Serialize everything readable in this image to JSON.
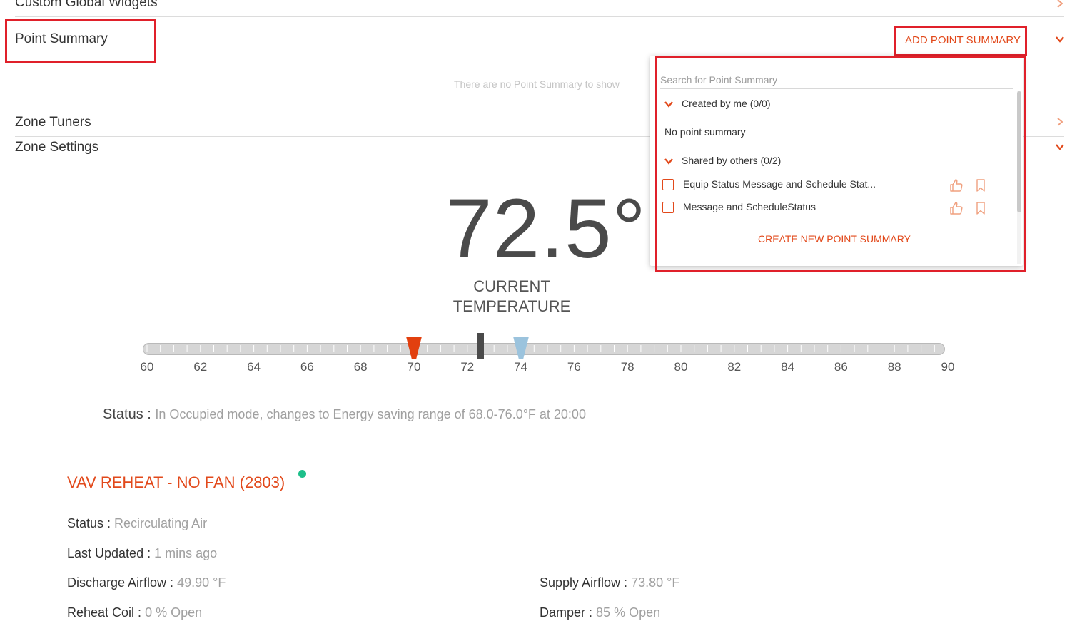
{
  "sections": {
    "custom_global_widgets": "Custom Global Widgets",
    "point_summary": "Point Summary",
    "point_summary_empty": "There are no Point Summary to show",
    "add_point_summary": "ADD POINT SUMMARY",
    "zone_tuners": "Zone Tuners",
    "zone_settings": "Zone Settings"
  },
  "temperature": {
    "value": "72.5°",
    "label_line1": "CURRENT",
    "label_line2": "TEMPERATURE",
    "current": 72.5,
    "heating_setpoint": 70,
    "cooling_setpoint": 74,
    "scale_min": 60,
    "scale_max": 90,
    "ticks": [
      "60",
      "62",
      "64",
      "66",
      "68",
      "70",
      "72",
      "74",
      "76",
      "78",
      "80",
      "82",
      "84",
      "86",
      "88",
      "90"
    ]
  },
  "status": {
    "label": "Status :",
    "value": "In Occupied mode, changes to Energy saving range of 68.0-76.0°F at 20:00"
  },
  "device": {
    "title": "VAV REHEAT - NO FAN (2803)",
    "online_color": "#1dbf8a",
    "status_label": "Status :",
    "status_value": "Recirculating Air",
    "updated_label": "Last Updated :",
    "updated_value": "1 mins ago",
    "discharge_label": "Discharge Airflow :",
    "discharge_value": "49.90 °F",
    "supply_label": "Supply Airflow :",
    "supply_value": "73.80 °F",
    "reheat_label": "Reheat Coil :",
    "reheat_value": "0 % Open",
    "damper_label": "Damper :",
    "damper_value": "85 % Open"
  },
  "dropdown": {
    "search_placeholder": "Search for Point Summary",
    "created_by_me": "Created by me (0/0)",
    "no_point_summary": "No point summary",
    "shared_by_others": "Shared by others (0/2)",
    "items": [
      {
        "label": "Equip Status Message and Schedule Stat..."
      },
      {
        "label": "Message and ScheduleStatus"
      }
    ],
    "create_new": "CREATE NEW POINT SUMMARY"
  },
  "colors": {
    "accent": "#e2491b",
    "heating_marker": "#e2400f",
    "cooling_marker": "#9bc3dd",
    "current_marker": "#4a4a4a",
    "highlight": "#e0202a"
  }
}
